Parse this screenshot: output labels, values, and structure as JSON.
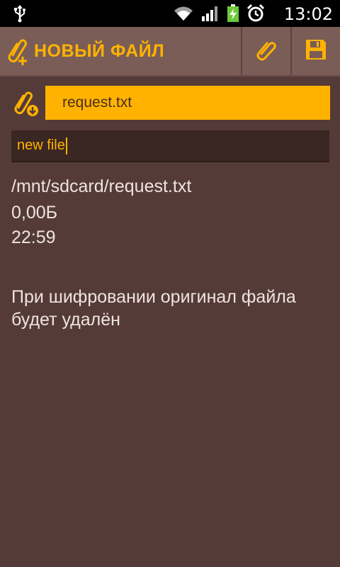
{
  "status_bar": {
    "time": "13:02",
    "icons": [
      "usb-icon",
      "wifi-icon",
      "signal-icon",
      "battery-charging-icon",
      "alarm-icon"
    ]
  },
  "action_bar": {
    "title": "НОВЫЙ ФАЙЛ",
    "accent_color": "#ffb300",
    "actions": [
      "attach-icon",
      "save-icon"
    ]
  },
  "file_picker": {
    "filename": "request.txt"
  },
  "name_input": {
    "value": "new file"
  },
  "file_info": {
    "path": "/mnt/sdcard/request.txt",
    "size": "0,00Б",
    "time": "22:59"
  },
  "warning": "При шифровании оригинал файла будет удалён"
}
